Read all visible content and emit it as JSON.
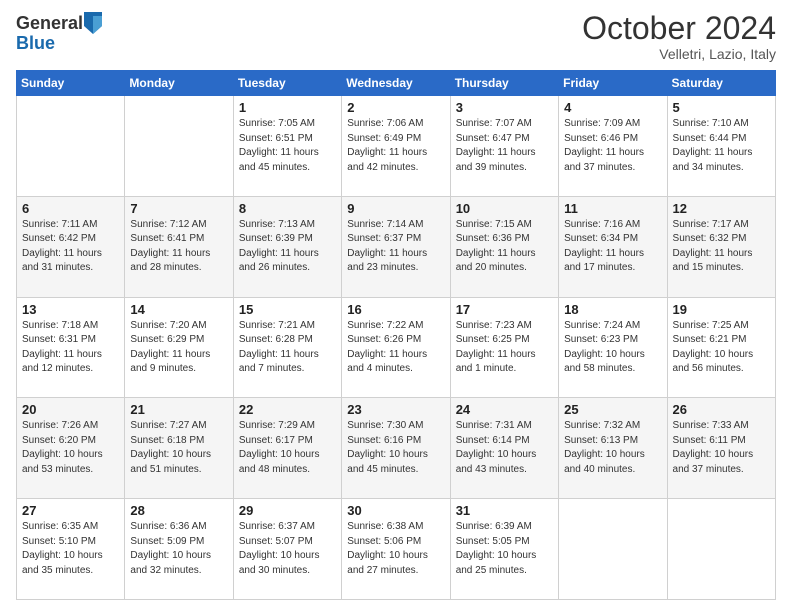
{
  "header": {
    "logo_general": "General",
    "logo_blue": "Blue",
    "month": "October 2024",
    "location": "Velletri, Lazio, Italy"
  },
  "weekdays": [
    "Sunday",
    "Monday",
    "Tuesday",
    "Wednesday",
    "Thursday",
    "Friday",
    "Saturday"
  ],
  "weeks": [
    [
      {
        "day": "",
        "info": ""
      },
      {
        "day": "",
        "info": ""
      },
      {
        "day": "1",
        "info": "Sunrise: 7:05 AM\nSunset: 6:51 PM\nDaylight: 11 hours and 45 minutes."
      },
      {
        "day": "2",
        "info": "Sunrise: 7:06 AM\nSunset: 6:49 PM\nDaylight: 11 hours and 42 minutes."
      },
      {
        "day": "3",
        "info": "Sunrise: 7:07 AM\nSunset: 6:47 PM\nDaylight: 11 hours and 39 minutes."
      },
      {
        "day": "4",
        "info": "Sunrise: 7:09 AM\nSunset: 6:46 PM\nDaylight: 11 hours and 37 minutes."
      },
      {
        "day": "5",
        "info": "Sunrise: 7:10 AM\nSunset: 6:44 PM\nDaylight: 11 hours and 34 minutes."
      }
    ],
    [
      {
        "day": "6",
        "info": "Sunrise: 7:11 AM\nSunset: 6:42 PM\nDaylight: 11 hours and 31 minutes."
      },
      {
        "day": "7",
        "info": "Sunrise: 7:12 AM\nSunset: 6:41 PM\nDaylight: 11 hours and 28 minutes."
      },
      {
        "day": "8",
        "info": "Sunrise: 7:13 AM\nSunset: 6:39 PM\nDaylight: 11 hours and 26 minutes."
      },
      {
        "day": "9",
        "info": "Sunrise: 7:14 AM\nSunset: 6:37 PM\nDaylight: 11 hours and 23 minutes."
      },
      {
        "day": "10",
        "info": "Sunrise: 7:15 AM\nSunset: 6:36 PM\nDaylight: 11 hours and 20 minutes."
      },
      {
        "day": "11",
        "info": "Sunrise: 7:16 AM\nSunset: 6:34 PM\nDaylight: 11 hours and 17 minutes."
      },
      {
        "day": "12",
        "info": "Sunrise: 7:17 AM\nSunset: 6:32 PM\nDaylight: 11 hours and 15 minutes."
      }
    ],
    [
      {
        "day": "13",
        "info": "Sunrise: 7:18 AM\nSunset: 6:31 PM\nDaylight: 11 hours and 12 minutes."
      },
      {
        "day": "14",
        "info": "Sunrise: 7:20 AM\nSunset: 6:29 PM\nDaylight: 11 hours and 9 minutes."
      },
      {
        "day": "15",
        "info": "Sunrise: 7:21 AM\nSunset: 6:28 PM\nDaylight: 11 hours and 7 minutes."
      },
      {
        "day": "16",
        "info": "Sunrise: 7:22 AM\nSunset: 6:26 PM\nDaylight: 11 hours and 4 minutes."
      },
      {
        "day": "17",
        "info": "Sunrise: 7:23 AM\nSunset: 6:25 PM\nDaylight: 11 hours and 1 minute."
      },
      {
        "day": "18",
        "info": "Sunrise: 7:24 AM\nSunset: 6:23 PM\nDaylight: 10 hours and 58 minutes."
      },
      {
        "day": "19",
        "info": "Sunrise: 7:25 AM\nSunset: 6:21 PM\nDaylight: 10 hours and 56 minutes."
      }
    ],
    [
      {
        "day": "20",
        "info": "Sunrise: 7:26 AM\nSunset: 6:20 PM\nDaylight: 10 hours and 53 minutes."
      },
      {
        "day": "21",
        "info": "Sunrise: 7:27 AM\nSunset: 6:18 PM\nDaylight: 10 hours and 51 minutes."
      },
      {
        "day": "22",
        "info": "Sunrise: 7:29 AM\nSunset: 6:17 PM\nDaylight: 10 hours and 48 minutes."
      },
      {
        "day": "23",
        "info": "Sunrise: 7:30 AM\nSunset: 6:16 PM\nDaylight: 10 hours and 45 minutes."
      },
      {
        "day": "24",
        "info": "Sunrise: 7:31 AM\nSunset: 6:14 PM\nDaylight: 10 hours and 43 minutes."
      },
      {
        "day": "25",
        "info": "Sunrise: 7:32 AM\nSunset: 6:13 PM\nDaylight: 10 hours and 40 minutes."
      },
      {
        "day": "26",
        "info": "Sunrise: 7:33 AM\nSunset: 6:11 PM\nDaylight: 10 hours and 37 minutes."
      }
    ],
    [
      {
        "day": "27",
        "info": "Sunrise: 6:35 AM\nSunset: 5:10 PM\nDaylight: 10 hours and 35 minutes."
      },
      {
        "day": "28",
        "info": "Sunrise: 6:36 AM\nSunset: 5:09 PM\nDaylight: 10 hours and 32 minutes."
      },
      {
        "day": "29",
        "info": "Sunrise: 6:37 AM\nSunset: 5:07 PM\nDaylight: 10 hours and 30 minutes."
      },
      {
        "day": "30",
        "info": "Sunrise: 6:38 AM\nSunset: 5:06 PM\nDaylight: 10 hours and 27 minutes."
      },
      {
        "day": "31",
        "info": "Sunrise: 6:39 AM\nSunset: 5:05 PM\nDaylight: 10 hours and 25 minutes."
      },
      {
        "day": "",
        "info": ""
      },
      {
        "day": "",
        "info": ""
      }
    ]
  ]
}
